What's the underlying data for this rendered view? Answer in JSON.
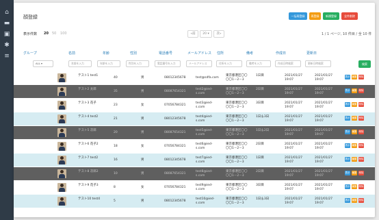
{
  "page": {
    "title": "顔登録"
  },
  "colors": {
    "page_bg": "#e9e9e9",
    "sidebar_bg": "#2f3b47",
    "row_light": "#ffffff",
    "row_blue": "#d6ecf2",
    "row_dark": "#5f5f5f",
    "header_text": "#2c7fb8",
    "blue": "#3498db",
    "orange": "#f39c12",
    "green": "#27ae60",
    "red": "#e74c3c"
  },
  "sidebar": {
    "icons": [
      "home-icon",
      "chart-icon",
      "id-card-icon",
      "settings-icon",
      "list-icon"
    ]
  },
  "top_buttons": [
    {
      "label": "一括再登録",
      "color": "#3498db"
    },
    {
      "label": "再登録",
      "color": "#f39c12"
    },
    {
      "label": "新規登録",
      "color": "#27ae60"
    },
    {
      "label": "全件削除",
      "color": "#e74c3c"
    }
  ],
  "display": {
    "label": "表示件数",
    "options": [
      "20",
      "50",
      "100"
    ],
    "selected": "20"
  },
  "pager": {
    "prev": "«前",
    "page": "20 ▾",
    "next": "次»"
  },
  "range_text": "1 / 1 ページ, 10 件目 / 全 10 件",
  "columns": [
    "グループ",
    "名前",
    "年齢",
    "性別",
    "電話番号",
    "メールアドレス",
    "住所",
    "備考",
    "作成日",
    "更新日"
  ],
  "filters": {
    "group": "ALL ▾",
    "name": "名前を入力",
    "age": "年齢を入力",
    "gender": "性別を入力",
    "phone": "電話番号を入力",
    "email": "メールアドレス",
    "address": "住所を入力",
    "note": "備考を入力",
    "created": "作成日時検索",
    "updated": "更新日時検索",
    "search_label": "検索"
  },
  "row_actions": [
    "表示",
    "編集",
    "削除"
  ],
  "rows": [
    {
      "name": "テスト1 test1",
      "age": "40",
      "gender": "男",
      "phone": "08012345678",
      "email": "test@sdfa.com",
      "address": [
        "東京都港区〇〇",
        "〇〇1－2－3"
      ],
      "note": "1日目",
      "created": [
        "2021/01/27",
        "19:07"
      ],
      "updated": [
        "2021/01/27",
        "19:07"
      ],
      "style": "light"
    },
    {
      "name": "テスト2 太郎",
      "age": "35",
      "gender": "男",
      "phone": "08087654321",
      "email": [
        "test2@ied-",
        "s.com"
      ],
      "address": [
        "東京都港区〇〇",
        "〇〇1－2－3"
      ],
      "note": "2日目",
      "created": [
        "2021/01/27",
        "19:07"
      ],
      "updated": [
        "2021/01/27",
        "19:07"
      ],
      "style": "dark"
    },
    {
      "name": "テスト3 花子",
      "age": "23",
      "gender": "女",
      "phone": "07056784321",
      "email": [
        "test3@ied-",
        "s.com"
      ],
      "address": [
        "東京都港区〇〇",
        "〇〇1－2－3"
      ],
      "note": "3日目",
      "created": [
        "2021/01/27",
        "19:07"
      ],
      "updated": [
        "2021/01/27",
        "19:07"
      ],
      "style": "light"
    },
    {
      "name": "テスト4 test2",
      "age": "21",
      "gender": "男",
      "phone": "08012345678",
      "email": [
        "test4@ied-",
        "s.com"
      ],
      "address": [
        "東京都港区〇〇",
        "〇〇1－2－3"
      ],
      "note": "1日＆3日",
      "created": [
        "2021/01/27",
        "19:07"
      ],
      "updated": [
        "2021/01/27",
        "19:07"
      ],
      "style": "blue"
    },
    {
      "name": "テスト5 次郎",
      "age": "20",
      "gender": "男",
      "phone": "08087654321",
      "email": [
        "test5@ied-",
        "s.com"
      ],
      "address": [
        "東京都港区〇〇",
        "〇〇1－2－3"
      ],
      "note": "1日＆2日",
      "created": [
        "2021/01/27",
        "19:07"
      ],
      "updated": [
        "2021/01/27",
        "19:07"
      ],
      "style": "dark"
    },
    {
      "name": "テスト6 花子2",
      "age": "18",
      "gender": "女",
      "phone": "07056784321",
      "email": [
        "test6@ied-",
        "s.com"
      ],
      "address": [
        "東京都港区〇〇",
        "〇〇1－2－3"
      ],
      "note": "2日目",
      "created": [
        "2021/01/27",
        "19:07"
      ],
      "updated": [
        "2021/01/27",
        "19:07"
      ],
      "style": "light"
    },
    {
      "name": "テスト7 test2",
      "age": "16",
      "gender": "男",
      "phone": "08012345678",
      "email": [
        "test7@ied-",
        "s.com"
      ],
      "address": [
        "東京都港区〇〇",
        "〇〇1－2－3"
      ],
      "note": "1日目",
      "created": [
        "2021/01/27",
        "19:07"
      ],
      "updated": [
        "2021/01/27",
        "19:07"
      ],
      "style": "blue"
    },
    {
      "name": "テスト8 次郎2",
      "age": "10",
      "gender": "男",
      "phone": "08087654321",
      "email": [
        "test8@ied-",
        "s.com"
      ],
      "address": [
        "東京都港区〇〇",
        "〇〇1－2－3"
      ],
      "note": "2日目",
      "created": [
        "2021/01/27",
        "19:07"
      ],
      "updated": [
        "2021/01/27",
        "19:07"
      ],
      "style": "dark"
    },
    {
      "name": "テスト9 花子3",
      "age": "8",
      "gender": "女",
      "phone": "07056784321",
      "email": [
        "test9@ied-",
        "s.com"
      ],
      "address": [
        "東京都港区〇〇",
        "〇〇1－2－3"
      ],
      "note": "3日目",
      "created": [
        "2021/01/27",
        "19:07"
      ],
      "updated": [
        "2021/01/27",
        "19:07"
      ],
      "style": "light"
    },
    {
      "name": "テスト10 test4",
      "age": "5",
      "gender": "男",
      "phone": "08012345678",
      "email": [
        "test10@ied-",
        "s.com"
      ],
      "address": [
        "東京都港区〇〇",
        "〇〇1－2－3"
      ],
      "note": "1日＆3日",
      "created": [
        "2021/01/27",
        "19:07"
      ],
      "updated": [
        "2021/01/27",
        "19:07"
      ],
      "style": "blue"
    }
  ]
}
